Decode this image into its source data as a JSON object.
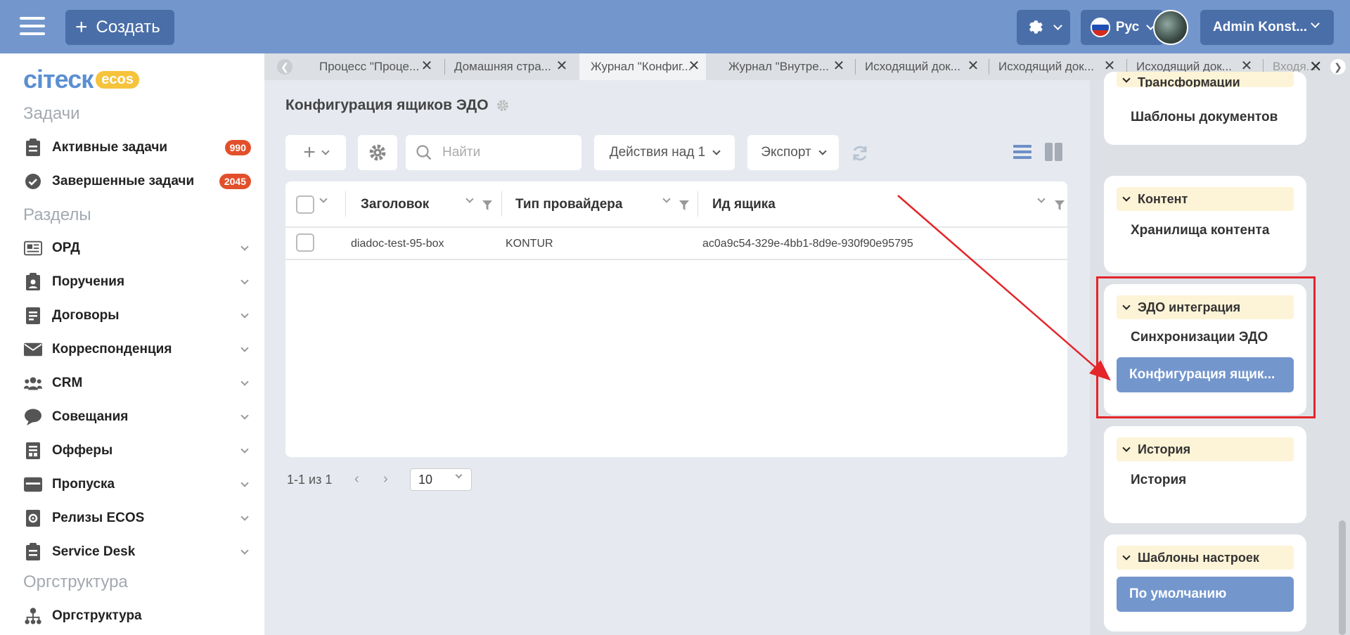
{
  "topbar": {
    "create_label": "Создать",
    "language": "Рус",
    "user_name": "Admin Konst..."
  },
  "sidebar": {
    "logo_text": "ciтеск",
    "logo_badge": "ecos",
    "sections": {
      "tasks": "Задачи",
      "sections": "Разделы",
      "orgstructure": "Оргструктура"
    },
    "tasks": [
      {
        "label": "Активные задачи",
        "badge": "990",
        "icon": "clipboard-icon"
      },
      {
        "label": "Завершенные задачи",
        "badge": "2045",
        "icon": "check-circle-icon"
      }
    ],
    "items": [
      {
        "label": "ОРД",
        "icon": "newspaper-icon"
      },
      {
        "label": "Поручения",
        "icon": "clipboard-user-icon"
      },
      {
        "label": "Договоры",
        "icon": "contract-icon"
      },
      {
        "label": "Корреспонденция",
        "icon": "envelope-icon"
      },
      {
        "label": "CRM",
        "icon": "users-icon"
      },
      {
        "label": "Совещания",
        "icon": "chat-bubble-icon"
      },
      {
        "label": "Офферы",
        "icon": "document-icon"
      },
      {
        "label": "Пропуска",
        "icon": "pass-card-icon"
      },
      {
        "label": "Релизы ECOS",
        "icon": "gear-doc-icon"
      },
      {
        "label": "Service Desk",
        "icon": "clipboard-icon"
      }
    ],
    "org_item": {
      "label": "Оргструктура",
      "icon": "org-chart-icon"
    }
  },
  "tabs": [
    {
      "label": "Процесс \"Проце..."
    },
    {
      "label": "Домашняя стра..."
    },
    {
      "label": "Журнал \"Конфиг...",
      "active": true
    },
    {
      "label": "Журнал \"Внутре..."
    },
    {
      "label": "Исходящий док..."
    },
    {
      "label": "Исходящий док..."
    },
    {
      "label": "Исходящий док..."
    },
    {
      "label": "Входя..."
    }
  ],
  "main": {
    "title": "Конфигурация ящиков ЭДО",
    "search_placeholder": "Найти",
    "actions_label": "Действия над 1",
    "export_label": "Экспорт",
    "columns": [
      "Заголовок",
      "Тип провайдера",
      "Ид ящика"
    ],
    "rows": [
      [
        "diadoc-test-95-box",
        "KONTUR",
        "ac0a9c54-329e-4bb1-8d9e-930f90e95795"
      ]
    ],
    "pagination": "1-1 из 1",
    "page_size": "10"
  },
  "right_panel": {
    "top_partial_header": "Трансформации",
    "top_link": "Шаблоны документов",
    "cards": [
      {
        "header": "Контент",
        "links": [
          "Хранилища контента"
        ]
      },
      {
        "header": "ЭДО интеграция",
        "links": [
          "Синхронизации ЭДО"
        ],
        "active_link": "Конфигурация ящик..."
      },
      {
        "header": "История",
        "links": [
          "История"
        ]
      },
      {
        "header": "Шаблоны настроек",
        "active_link": "По умолчанию"
      }
    ]
  },
  "colors": {
    "topbar": "#7396cd",
    "button_dark": "#4a6ea8",
    "badge": "#e2502b",
    "highlight": "#e4252a",
    "card_header": "#fdf3d7"
  }
}
